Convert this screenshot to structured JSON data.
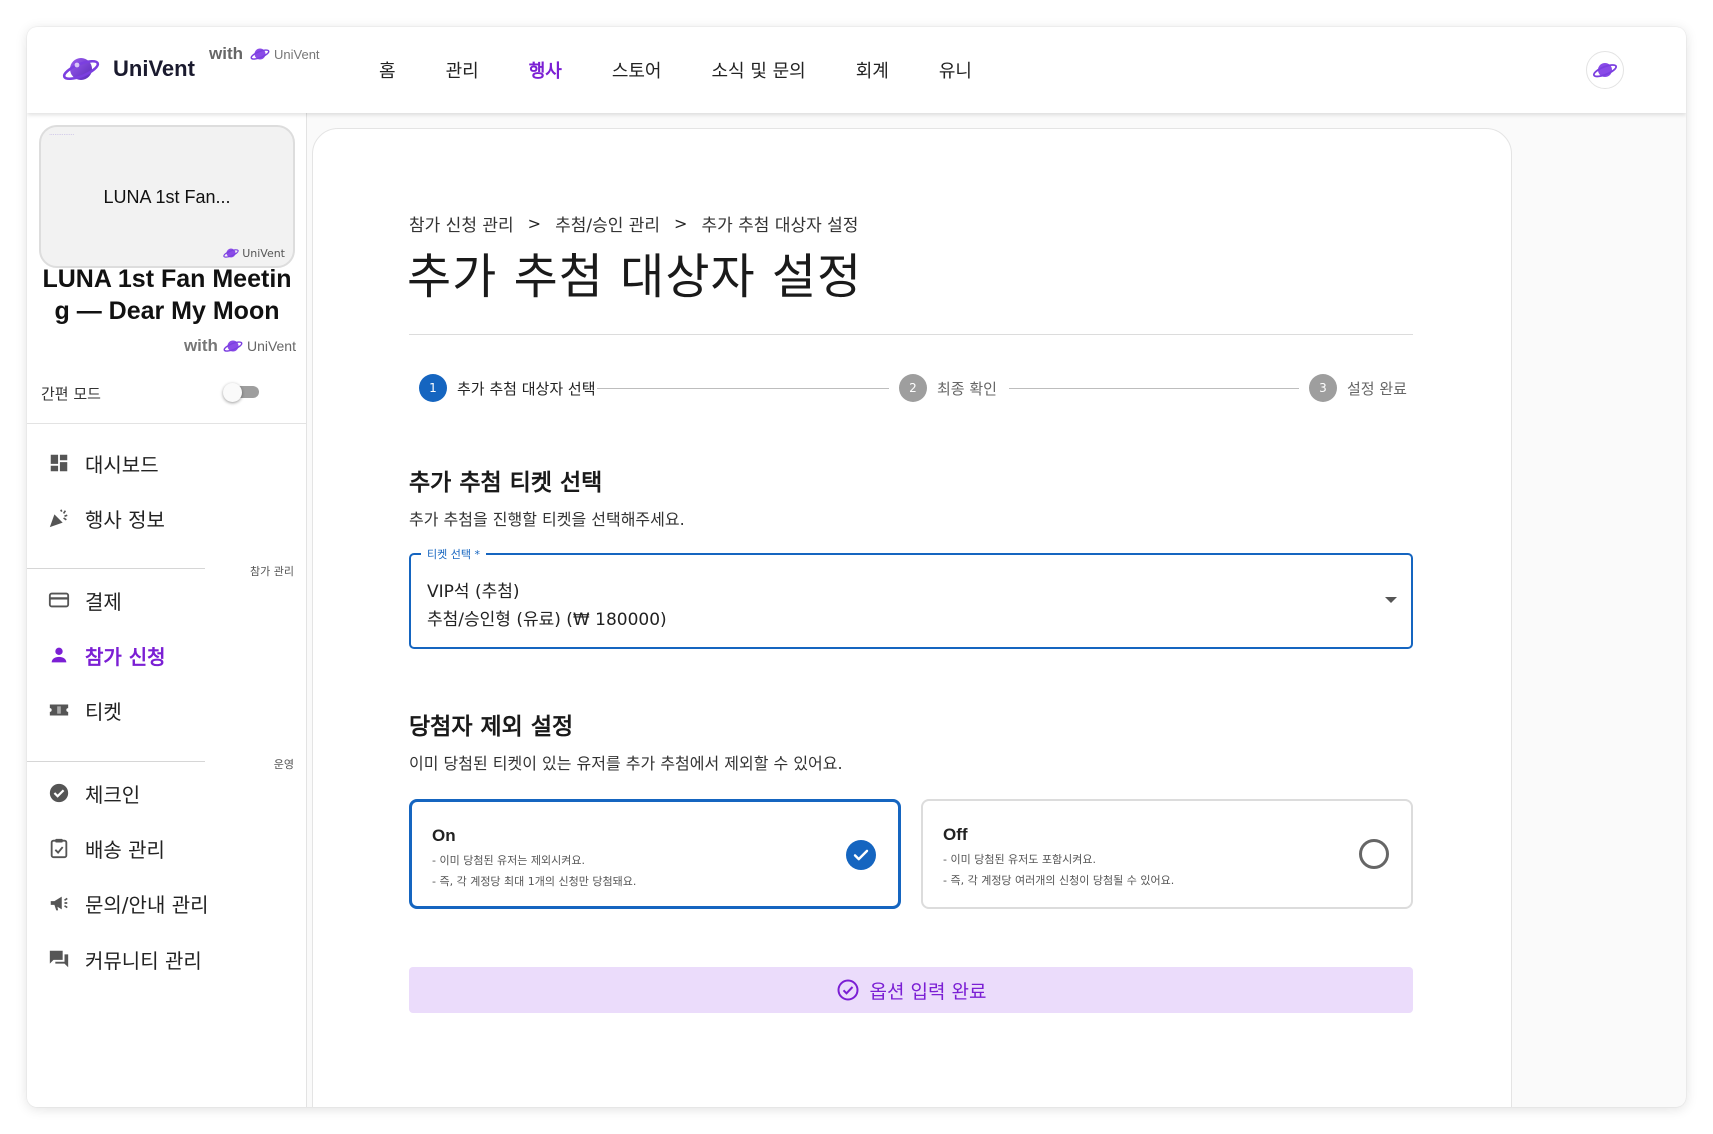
{
  "brand": {
    "name": "UniVent",
    "with": "with",
    "partner": "UniVent"
  },
  "nav": {
    "items": [
      "홈",
      "관리",
      "행사",
      "스토어",
      "소식 및 문의",
      "회계",
      "유니"
    ],
    "active_index": 2
  },
  "sidebar": {
    "card_title": "LUNA 1st Fan...",
    "card_brand": "UniVent",
    "event_name": "LUNA 1st Fan Meeting — Dear My Moon",
    "event_with": "with",
    "event_partner": "UniVent",
    "simple_mode_label": "간편 모드",
    "menu": [
      {
        "label": "대시보드",
        "icon": "dashboard-icon"
      },
      {
        "label": "행사 정보",
        "icon": "celebration-icon"
      },
      {
        "label": "결제",
        "icon": "credit-card-icon"
      },
      {
        "label": "참가 신청",
        "icon": "person-icon",
        "active": true
      },
      {
        "label": "티켓",
        "icon": "ticket-icon"
      },
      {
        "label": "체크인",
        "icon": "check-circle-icon"
      },
      {
        "label": "배송 관리",
        "icon": "clipboard-check-icon"
      },
      {
        "label": "문의/안내 관리",
        "icon": "megaphone-icon"
      },
      {
        "label": "커뮤니티 관리",
        "icon": "forum-icon"
      }
    ],
    "sections": [
      "참가 관리",
      "운영"
    ]
  },
  "main": {
    "breadcrumb": [
      "참가 신청 관리",
      "추첨/승인 관리",
      "추가 추첨 대상자 설정"
    ],
    "title": "추가 추첨 대상자 설정",
    "steps": [
      {
        "num": "1",
        "label": "추가 추첨 대상자 선택"
      },
      {
        "num": "2",
        "label": "최종 확인"
      },
      {
        "num": "3",
        "label": "설정 완료"
      }
    ],
    "ticket_section": {
      "title": "추가 추첨 티켓 선택",
      "desc": "추가 추첨을 진행할 티켓을 선택해주세요.",
      "field_label": "티켓 선택 *",
      "value_line1": "VIP석 (추첨)",
      "value_line2": "추첨/승인형 (유료) (₩ 180000)"
    },
    "exclude_section": {
      "title": "당첨자 제외 설정",
      "desc": "이미 당첨된 티켓이 있는 유저를 추가 추첨에서 제외할 수 있어요.",
      "on": {
        "title": "On",
        "l1": "- 이미 당첨된 유저는 제외시켜요.",
        "l2": "- 즉, 각 계정당 최대 1개의 신청만 당첨돼요."
      },
      "off": {
        "title": "Off",
        "l1": "- 이미 당첨된 유저도 포함시켜요.",
        "l2": "- 즉, 각 계정당 여러개의 신청이 당첨될 수 있어요."
      },
      "selected": "On"
    },
    "done_button": "옵션 입력 완료"
  },
  "colors": {
    "accent": "#7b1fd4",
    "primary": "#1565c0",
    "button_bg": "#ebdcfb"
  }
}
